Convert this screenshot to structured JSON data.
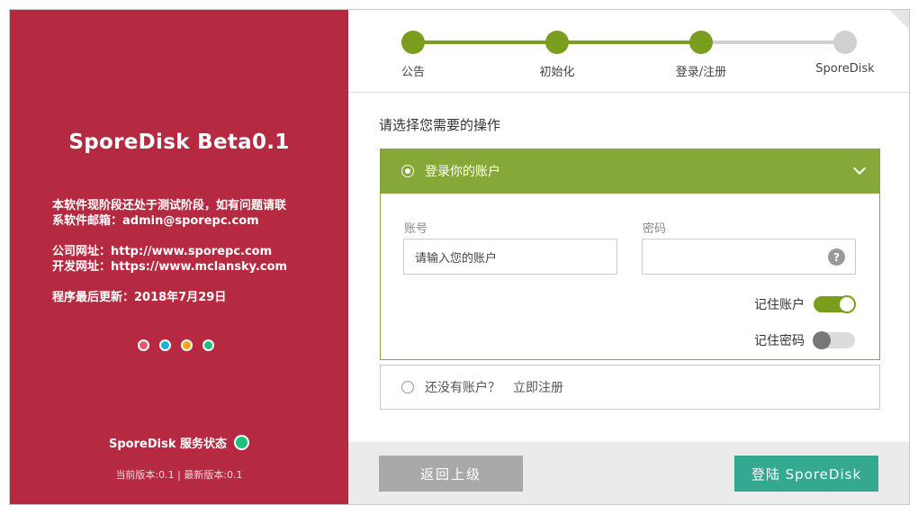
{
  "left_panel": {
    "title": "SporeDisk Beta0.1",
    "notice_line1": "本软件现阶段还处于测试阶段，如有问题请联",
    "notice_line2": "系软件邮箱：admin@sporepc.com",
    "website": "公司网址：http://www.sporepc.com",
    "dev_site": "开发网址：https://www.mclansky.com",
    "updated": "程序最后更新：2018年7月29日",
    "dot_colors": [
      "#e05a7a",
      "#1ab3d6",
      "#f0a81a",
      "#20c07b"
    ],
    "service_status_label": "SporeDisk 服务状态",
    "service_status_color": "#20c07b",
    "version_text": "当前版本:0.1 | 最新版本:0.1"
  },
  "stepper": {
    "steps": [
      {
        "label": "公告",
        "state": "done"
      },
      {
        "label": "初始化",
        "state": "done"
      },
      {
        "label": "登录/注册",
        "state": "current"
      },
      {
        "label": "SporeDisk",
        "state": "pending"
      }
    ],
    "active_color": "#7a9d1d",
    "inactive_color": "#d0d0d0"
  },
  "main": {
    "prompt": "请选择您需要的操作",
    "login_option": {
      "title": "登录你的账户",
      "account_label": "账号",
      "account_placeholder": "请输入您的账户",
      "password_label": "密码",
      "password_value": "",
      "help_glyph": "?",
      "remember_account_label": "记住账户",
      "remember_account": true,
      "remember_password_label": "记住密码",
      "remember_password": false
    },
    "register_option": {
      "question": "还没有账户？",
      "link": "立即注册"
    }
  },
  "footer": {
    "back_label": "返回上级",
    "login_label": "登陆 SporeDisk"
  }
}
